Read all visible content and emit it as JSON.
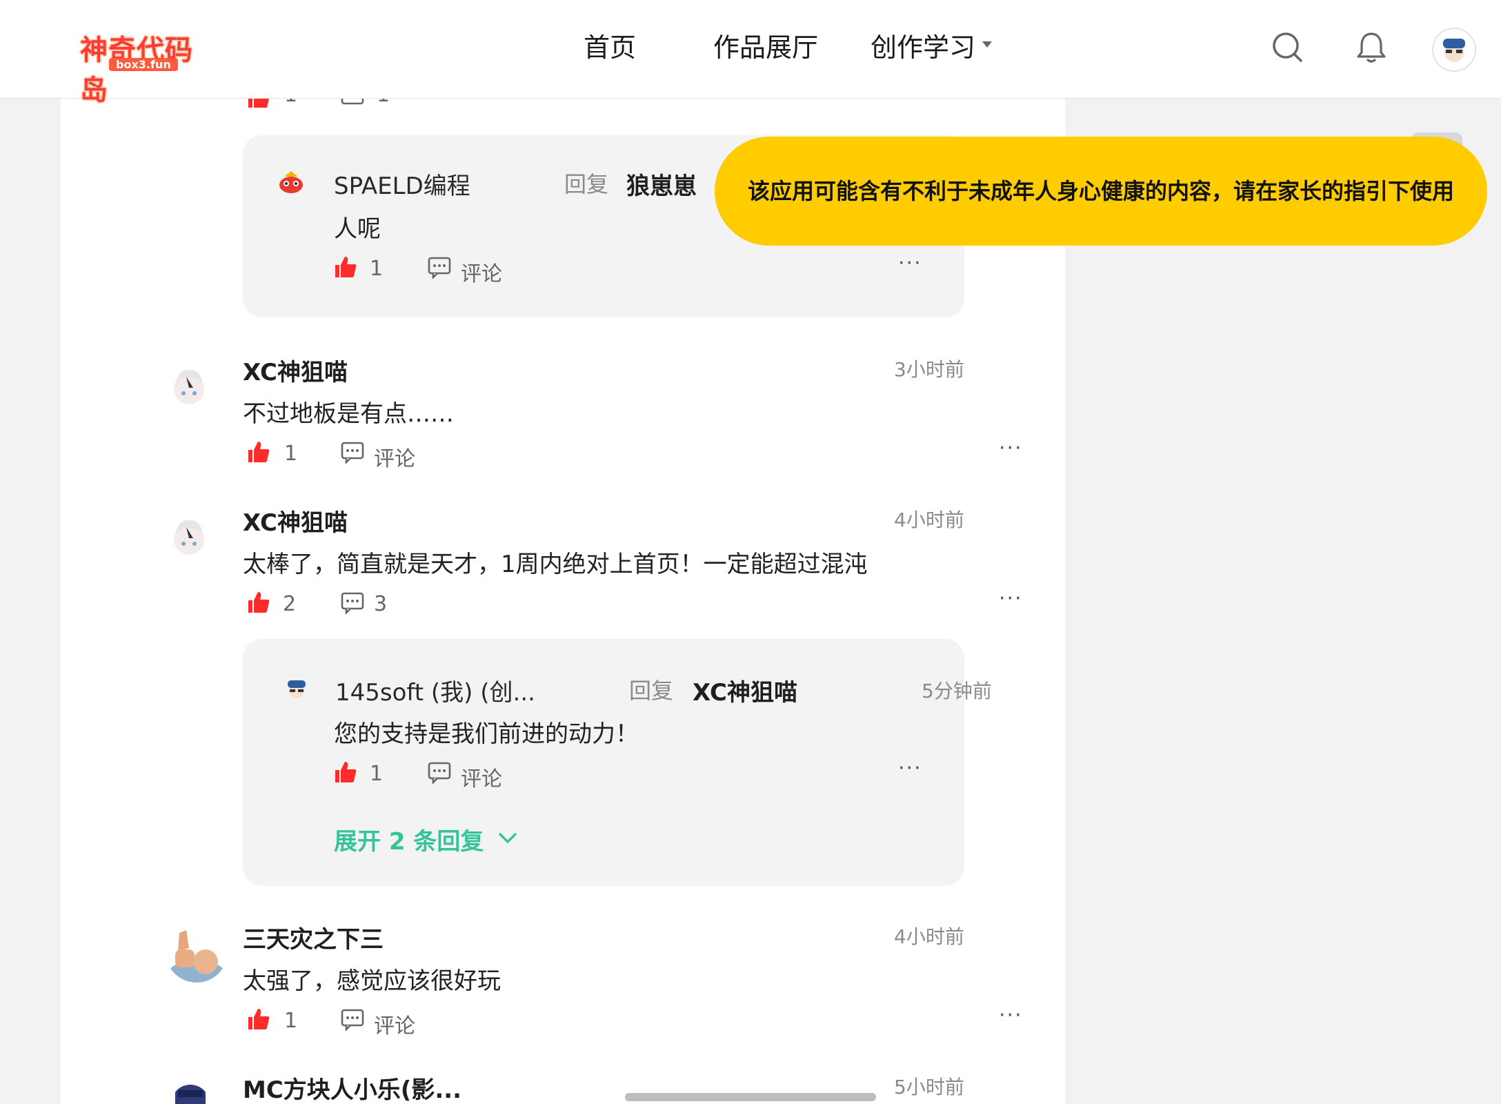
{
  "header": {
    "logo_text": "神奇代码岛",
    "logo_sub": "box3.fun",
    "nav": [
      "首页",
      "作品展厅",
      "创作学习"
    ]
  },
  "warning": "该应用可能含有不利于未成年人身心健康的内容，请在家长的指引下使用",
  "labels": {
    "comment": "评论",
    "reply": "回复"
  },
  "top_partial": {
    "like_count": "1",
    "comment_count": "1"
  },
  "reply1": {
    "author": "SPAELD编程",
    "target": "狼崽崽",
    "text": "人呢",
    "likes": "1"
  },
  "comments": [
    {
      "author": "XC神狙喵",
      "time": "3小时前",
      "text": "不过地板是有点……",
      "likes": "1"
    },
    {
      "author": "XC神狙喵",
      "time": "4小时前",
      "text": "太棒了，简直就是天才，1周内绝对上首页！一定能超过混沌",
      "likes": "2",
      "comments": "3"
    },
    {
      "author": "三天灾之下三",
      "time": "4小时前",
      "text": "太强了，感觉应该很好玩",
      "likes": "1"
    },
    {
      "author": "MC方块人小乐(影...",
      "time": "5小时前"
    }
  ],
  "reply2": {
    "author": "145soft (我) (创...",
    "target": "XC神狙喵",
    "time": "5分钟前",
    "text": "您的支持是我们前进的动力！",
    "likes": "1",
    "expand": "展开 2 条回复"
  },
  "colors": {
    "accent_green": "#34c49a",
    "warning_yellow": "#ffcc00",
    "like_red": "#ff2a2a"
  }
}
